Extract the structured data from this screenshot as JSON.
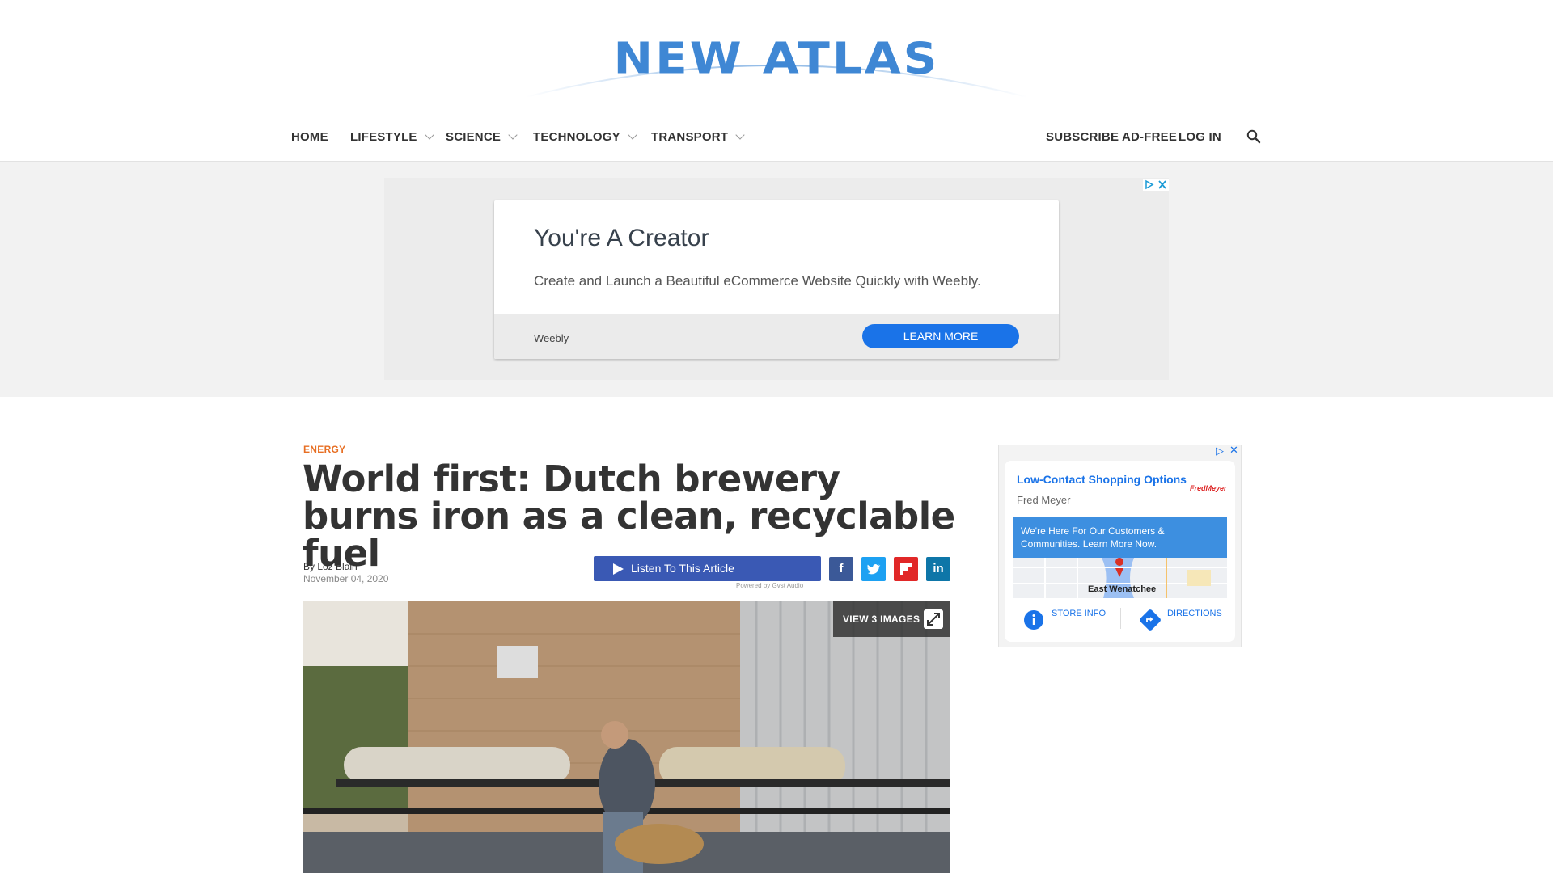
{
  "logo": {
    "text": "NEW ATLAS",
    "color": "#3f87d4"
  },
  "nav": {
    "items": [
      {
        "label": "HOME",
        "dropdown": false
      },
      {
        "label": "LIFESTYLE",
        "dropdown": true
      },
      {
        "label": "SCIENCE",
        "dropdown": true
      },
      {
        "label": "TECHNOLOGY",
        "dropdown": true
      },
      {
        "label": "TRANSPORT",
        "dropdown": true
      }
    ],
    "subscribe_label": "SUBSCRIBE AD-FREE",
    "login_label": "LOG IN",
    "search_icon": "search-icon"
  },
  "top_ad": {
    "title": "You're A Creator",
    "description": "Create and Launch a Beautiful eCommerce Website Quickly with Weebly.",
    "brand": "Weebly",
    "cta": "LEARN MORE",
    "cta_color": "#1a73e8"
  },
  "article": {
    "category": "ENERGY",
    "category_color": "#e76f24",
    "headline": "World first: Dutch brewery burns iron as a clean, recyclable fuel",
    "byline": "By Loz Blain",
    "date": "November 04, 2020",
    "listen_label": "Listen To This Article",
    "powered_by": "Powered by  Gvst Audio",
    "view_images_label": "VIEW 3 IMAGES",
    "share": [
      {
        "name": "facebook",
        "glyph": "f",
        "color": "#3b5998"
      },
      {
        "name": "twitter",
        "glyph": "t",
        "color": "#1da1f2"
      },
      {
        "name": "flipboard",
        "glyph": "f",
        "color": "#e12828"
      },
      {
        "name": "linkedin",
        "glyph": "in",
        "color": "#0e76a8"
      }
    ]
  },
  "side_ad": {
    "title": "Low-Contact Shopping Options",
    "advertiser": "Fred Meyer",
    "brand_logo": "FredMeyer",
    "banner": "We're Here For Our Customers & Communities. Learn More Now.",
    "map_label": "East Wenatchee",
    "store_info": "STORE INFO",
    "directions": "DIRECTIONS"
  }
}
